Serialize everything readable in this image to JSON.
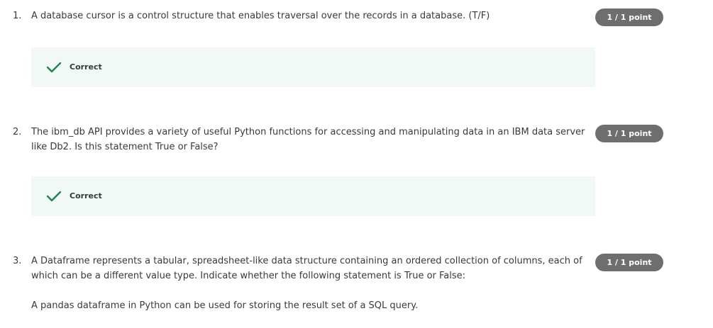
{
  "questions": [
    {
      "number": "1.",
      "text": "A database cursor is a control structure that enables traversal over the records in a database. (T/F)",
      "points": "1 / 1 point",
      "feedback": "Correct",
      "feedback_icon": "checkmark-icon"
    },
    {
      "number": "2.",
      "text": "The ibm_db API provides a variety of useful Python functions for accessing and manipulating data in an IBM data server like Db2. Is this statement True or False?",
      "points": "1 / 1 point",
      "feedback": "Correct",
      "feedback_icon": "checkmark-icon"
    },
    {
      "number": "3.",
      "text": "A Dataframe represents a tabular, spreadsheet-like data structure containing an ordered collection of columns, each of which can be a different value type. Indicate whether the following statement is True or False:",
      "extra": "A pandas dataframe in Python can be used for storing the result set of a SQL query.",
      "points": "1 / 1 point"
    }
  ],
  "colors": {
    "badge_bg": "#6d6e70",
    "feedback_bg": "#f1f8f5",
    "check_color": "#1f8354",
    "text": "#373a3c"
  }
}
